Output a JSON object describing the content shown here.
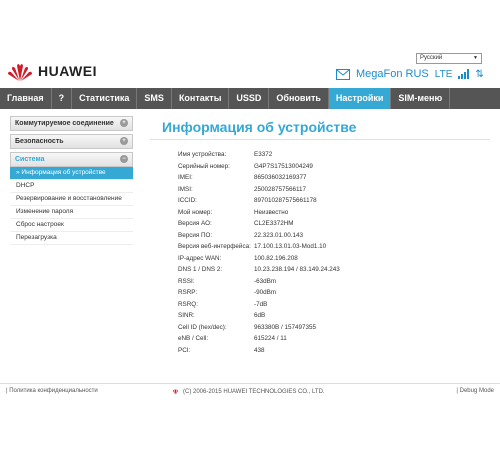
{
  "language": {
    "selected": "Русский"
  },
  "brand": {
    "name": "HUAWEI"
  },
  "status": {
    "operator": "MegaFon RUS",
    "network": "LTE"
  },
  "nav": [
    "Главная",
    "?",
    "Статистика",
    "SMS",
    "Контакты",
    "USSD",
    "Обновить",
    "Настройки",
    "SIM-меню"
  ],
  "nav_active": 7,
  "sidebar": {
    "groups": [
      {
        "label": "Коммутируемое соединение",
        "icon": "plus-icon"
      },
      {
        "label": "Безопасность",
        "icon": "plus-icon"
      },
      {
        "label": "Система",
        "icon": "minus-icon"
      }
    ],
    "system_items": [
      "Информация об устройстве",
      "DHCP",
      "Резервирование и восстановление",
      "Изменение пароля",
      "Сброс настроек",
      "Перезагрузка"
    ]
  },
  "page_title": "Информация об устройстве",
  "info": [
    {
      "k": "Имя устройства:",
      "v": "E3372"
    },
    {
      "k": "Серийный номер:",
      "v": "G4P7S17513004249"
    },
    {
      "k": "IMEI:",
      "v": "865036032169377"
    },
    {
      "k": "IMSI:",
      "v": "250028757566117"
    },
    {
      "k": "ICCID:",
      "v": "897010287575661178"
    },
    {
      "k": "Мой номер:",
      "v": "Неизвестно"
    },
    {
      "k": "Версия АО:",
      "v": "CL2E3372HM"
    },
    {
      "k": "Версия ПО:",
      "v": "22.323.01.00.143"
    },
    {
      "k": "Версия веб-интерфейса:",
      "v": "17.100.13.01.03-Mod1.10"
    },
    {
      "k": "IP-адрес WAN:",
      "v": "100.82.196.208"
    },
    {
      "k": "DNS 1 / DNS 2:",
      "v": "10.23.238.194 / 83.149.24.243"
    },
    {
      "k": "RSSI:",
      "v": "-63dBm"
    },
    {
      "k": "RSRP:",
      "v": "-90dBm"
    },
    {
      "k": "RSRQ:",
      "v": "-7dB"
    },
    {
      "k": "SINR:",
      "v": "6dB"
    },
    {
      "k": "Cell ID (hex/dec):",
      "v": "963380B / 157497355"
    },
    {
      "k": "eNB / Cell:",
      "v": "615224 / 11"
    },
    {
      "k": "PCI:",
      "v": "438"
    }
  ],
  "footer": {
    "privacy": "Политика конфиденциальности",
    "copyright": "(C) 2006-2015 HUAWEI TECHNOLOGIES CO., LTD.",
    "debug": "Debug Mode"
  },
  "colors": {
    "accent": "#35a9d4",
    "nav_bg": "#555555",
    "logo_red": "#cf1e2b"
  }
}
